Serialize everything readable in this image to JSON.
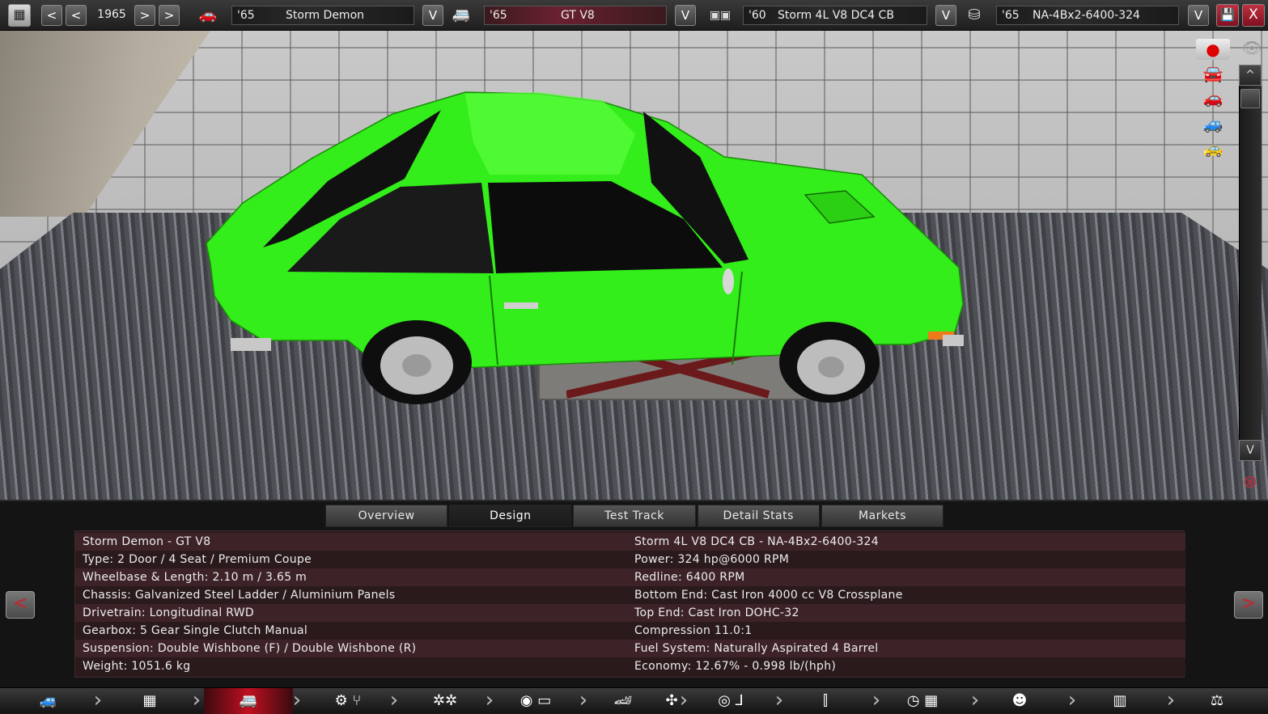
{
  "topbar": {
    "year": "1965",
    "year_prev_labels": [
      "<",
      "<"
    ],
    "year_next_labels": [
      ">",
      ">"
    ],
    "model": {
      "year": "'65",
      "name": "Storm Demon"
    },
    "trim": {
      "year": "'65",
      "name": "GT V8"
    },
    "engine_family": {
      "year": "'60",
      "name": "Storm 4L V8 DC4 CB"
    },
    "engine_variant": {
      "year": "'65",
      "name": "NA-4Bx2-6400-324"
    },
    "dropdown_label": "V",
    "close_label": "X"
  },
  "viewport": {
    "car_color": "#33ee1a",
    "scroll_up_label": "^",
    "scroll_down_label": "V"
  },
  "tabs": [
    "Overview",
    "Design",
    "Test Track",
    "Detail Stats",
    "Markets"
  ],
  "active_tab": "Design",
  "info": {
    "left": [
      "Storm Demon - GT V8",
      "Type: 2 Door / 4 Seat / Premium Coupe",
      "Wheelbase & Length: 2.10 m / 3.65 m",
      "Chassis: Galvanized Steel Ladder / Aluminium Panels",
      "Drivetrain: Longitudinal RWD",
      "Gearbox: 5 Gear Single Clutch Manual",
      "Suspension: Double Wishbone (F) / Double Wishbone (R)",
      "Weight: 1051.6 kg"
    ],
    "right": [
      "Storm 4L V8 DC4 CB - NA-4Bx2-6400-324",
      "Power: 324 hp@6000 RPM",
      "Redline: 6400 RPM",
      "Bottom End: Cast Iron 4000 cc V8 Crossplane",
      "Top End: Cast Iron DOHC-32",
      "Compression 11.0:1",
      "Fuel System: Naturally Aspirated 4 Barrel",
      "Economy: 12.67% - 0.998 lb/(hph)"
    ]
  },
  "nav": {
    "prev_label": "<",
    "next_label": ">"
  },
  "bottom_icons": [
    "car-icon",
    "chassis-icon",
    "body-icon",
    "gearbox-icon",
    "wheels-icon",
    "brakes-icon",
    "car-design-icon",
    "engine-cooling-icon",
    "interior-icon",
    "fixtures-icon",
    "test-track-icon",
    "engineer-icon",
    "factory-icon",
    "balance-icon"
  ]
}
